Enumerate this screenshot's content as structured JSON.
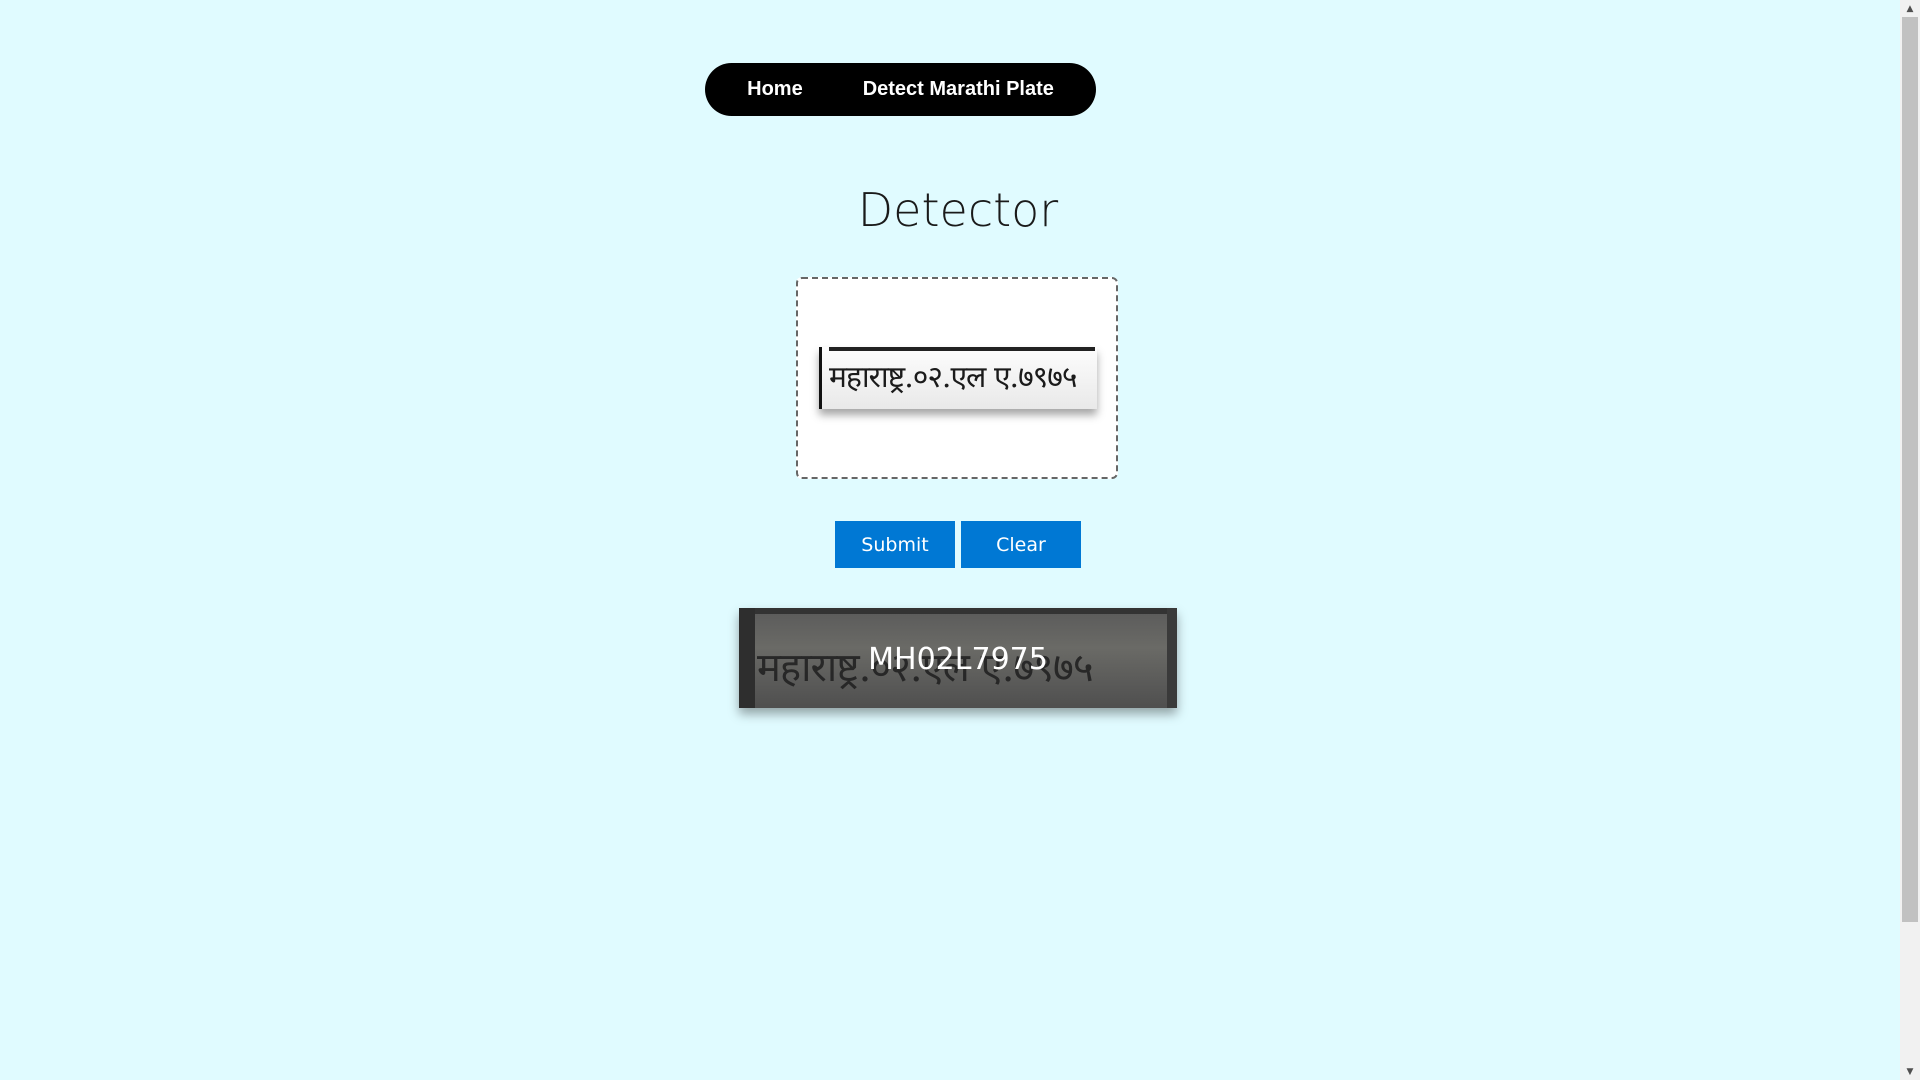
{
  "nav": {
    "home_label": "Home",
    "detect_label": "Detect Marathi Plate"
  },
  "page": {
    "title": "Detector"
  },
  "upload": {
    "preview_plate_text": "महाराष्ट्र.०२.एल ए.७९७५"
  },
  "actions": {
    "submit_label": "Submit",
    "clear_label": "Clear"
  },
  "result": {
    "background_plate_text": "महाराष्ट्र.०२.एल ए.७९७५",
    "detected_plate": "MH02L7975"
  },
  "scrollbar": {
    "up_icon": "scroll-up-arrow-icon",
    "down_icon": "scroll-down-arrow-icon"
  }
}
